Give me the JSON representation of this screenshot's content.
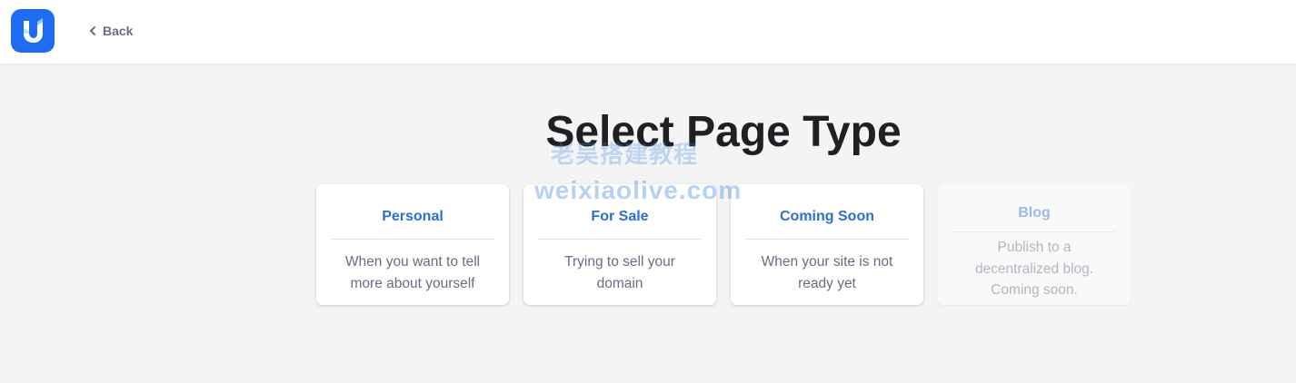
{
  "header": {
    "back_label": "Back",
    "logo_icon": "ud-logo-icon",
    "brand_color": "#1d6cf2"
  },
  "main": {
    "title": "Select Page Type",
    "cards": [
      {
        "title": "Personal",
        "description": "When you want to tell more about yourself",
        "enabled": true
      },
      {
        "title": "For Sale",
        "description": "Trying to sell your domain",
        "enabled": true
      },
      {
        "title": "Coming Soon",
        "description": "When your site is not ready yet",
        "enabled": true
      },
      {
        "title": "Blog",
        "description": "Publish to a decentralized blog. Coming soon.",
        "enabled": false
      }
    ]
  },
  "watermark": {
    "chinese": "老吴搭建教程",
    "url": "weixiaolive.com"
  },
  "colors": {
    "accent": "#2a6fd6",
    "title_text": "#1f1f24",
    "muted_text": "#6b6b85",
    "background": "#f4f4f5"
  }
}
